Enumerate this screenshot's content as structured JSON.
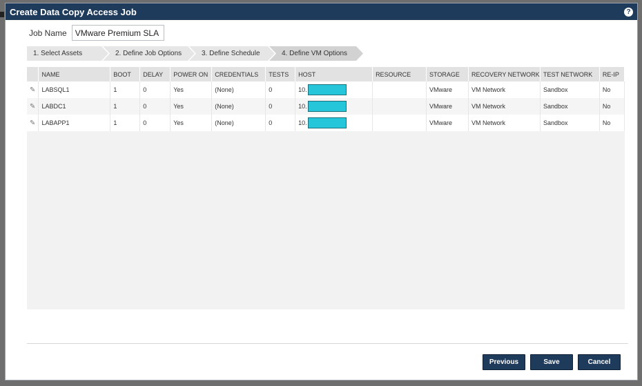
{
  "dialog": {
    "title": "Create Data Copy Access Job",
    "help_icon": "?"
  },
  "job_name": {
    "label": "Job Name",
    "value": "VMware Premium SLA"
  },
  "steps": [
    {
      "label": "1. Select Assets"
    },
    {
      "label": "2. Define Job Options"
    },
    {
      "label": "3. Define Schedule"
    },
    {
      "label": "4. Define VM Options",
      "active": true
    }
  ],
  "table": {
    "columns": [
      "NAME",
      "BOOT",
      "DELAY",
      "POWER ON",
      "CREDENTIALS",
      "TESTS",
      "HOST",
      "RESOURCE",
      "STORAGE",
      "RECOVERY NETWORK",
      "TEST NETWORK",
      "RE-IP"
    ],
    "rows": [
      {
        "name": "LABSQL1",
        "boot": "1",
        "delay": "0",
        "power_on": "Yes",
        "credentials": "(None)",
        "tests": "0",
        "host": "10.",
        "resource": "",
        "storage": "VMware",
        "recovery_network": "VM Network",
        "test_network": "Sandbox",
        "re_ip": "No"
      },
      {
        "name": "LABDC1",
        "boot": "1",
        "delay": "0",
        "power_on": "Yes",
        "credentials": "(None)",
        "tests": "0",
        "host": "10.",
        "resource": "",
        "storage": "VMware",
        "recovery_network": "VM Network",
        "test_network": "Sandbox",
        "re_ip": "No"
      },
      {
        "name": "LABAPP1",
        "boot": "1",
        "delay": "0",
        "power_on": "Yes",
        "credentials": "(None)",
        "tests": "0",
        "host": "10.",
        "resource": "",
        "storage": "VMware",
        "recovery_network": "VM Network",
        "test_network": "Sandbox",
        "re_ip": "No"
      }
    ]
  },
  "buttons": {
    "previous": "Previous",
    "save": "Save",
    "cancel": "Cancel"
  },
  "colors": {
    "titlebar": "#1f3b5c",
    "button": "#1f3b5c",
    "redaction": "#26c6da"
  }
}
